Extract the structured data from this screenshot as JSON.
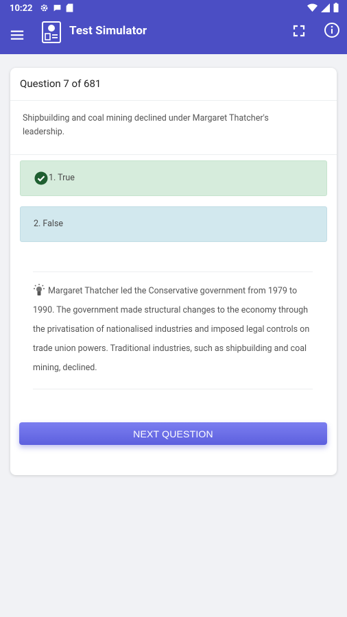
{
  "status_bar": {
    "time": "10:22"
  },
  "app_bar": {
    "title": "Test Simulator"
  },
  "question": {
    "counter": "Question 7 of 681",
    "text": "Shipbuilding and coal mining declined under Margaret Thatcher's leadership."
  },
  "options": [
    {
      "label": "1. True",
      "state": "correct",
      "color": "#d6ecdc"
    },
    {
      "label": "2. False",
      "state": "unselected",
      "color": "#d2e8ee"
    }
  ],
  "explanation": {
    "text": "Margaret Thatcher led the Conservative government from 1979 to 1990. The government made structural changes to the economy through the privatisation of nationalised industries and imposed legal controls on trade union powers. Traditional industries, such as shipbuilding and coal mining, declined."
  },
  "next_button": {
    "label": "NEXT QUESTION"
  },
  "colors": {
    "primary": "#4b4ec4",
    "button": "#6366e6",
    "correct_check": "#1f5f31"
  }
}
